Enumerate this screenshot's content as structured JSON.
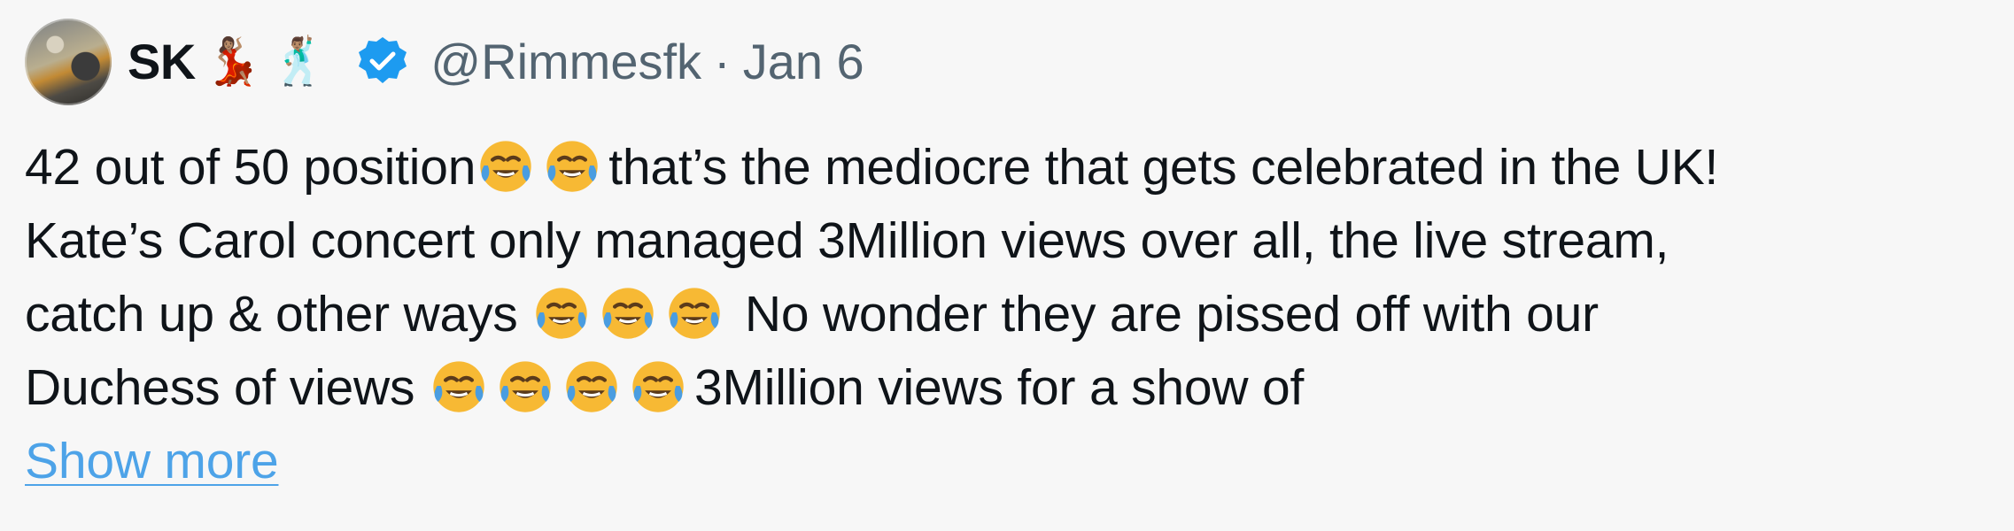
{
  "tweet": {
    "author_name": "SK",
    "author_emojis": [
      "💃🏽",
      "🕺🏽"
    ],
    "handle": "@Rimmesfk",
    "separator": "·",
    "date": "Jan 6",
    "verified_icon": "verified-badge-icon",
    "verified_color": "#1d9bf0",
    "link_color": "#4da3e8",
    "text_lines": [
      {
        "parts": [
          "42 out of 50 position",
          "",
          "",
          "that’s the mediocre that gets celebrated in the UK!"
        ]
      },
      {
        "parts": [
          "Kate’s Carol concert only managed 3Million views over all, the live stream,"
        ]
      },
      {
        "parts": [
          "catch up & other ways ",
          "",
          "",
          "",
          " No wonder they are pissed off with our"
        ]
      },
      {
        "parts": [
          "Duchess of views ",
          "",
          "",
          "",
          "",
          "3Million views for a show of"
        ]
      }
    ],
    "show_more_label": "Show more"
  },
  "emoji": {
    "name": "face-with-tears-of-joy-icon",
    "face_color": "#f7b934",
    "tear_color": "#4a9de0",
    "mouth_color": "#5b3b1b"
  }
}
